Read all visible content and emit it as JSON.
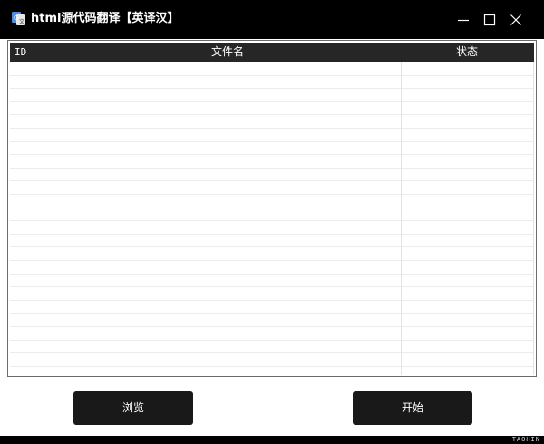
{
  "window": {
    "title": "html源代码翻译【英译汉】",
    "icon": "app-translate-icon"
  },
  "window_controls": {
    "minimize": "minimize-icon",
    "maximize": "maximize-icon",
    "close": "close-icon"
  },
  "table": {
    "columns": [
      {
        "label": "ID"
      },
      {
        "label": "文件名"
      },
      {
        "label": "状态"
      }
    ],
    "rows": []
  },
  "buttons": {
    "browse_label": "浏览",
    "start_label": "开始"
  },
  "watermark": {
    "text": "TAOHIN"
  },
  "colors": {
    "titlebar": "#000000",
    "header": "#262626",
    "button": "#191919"
  }
}
